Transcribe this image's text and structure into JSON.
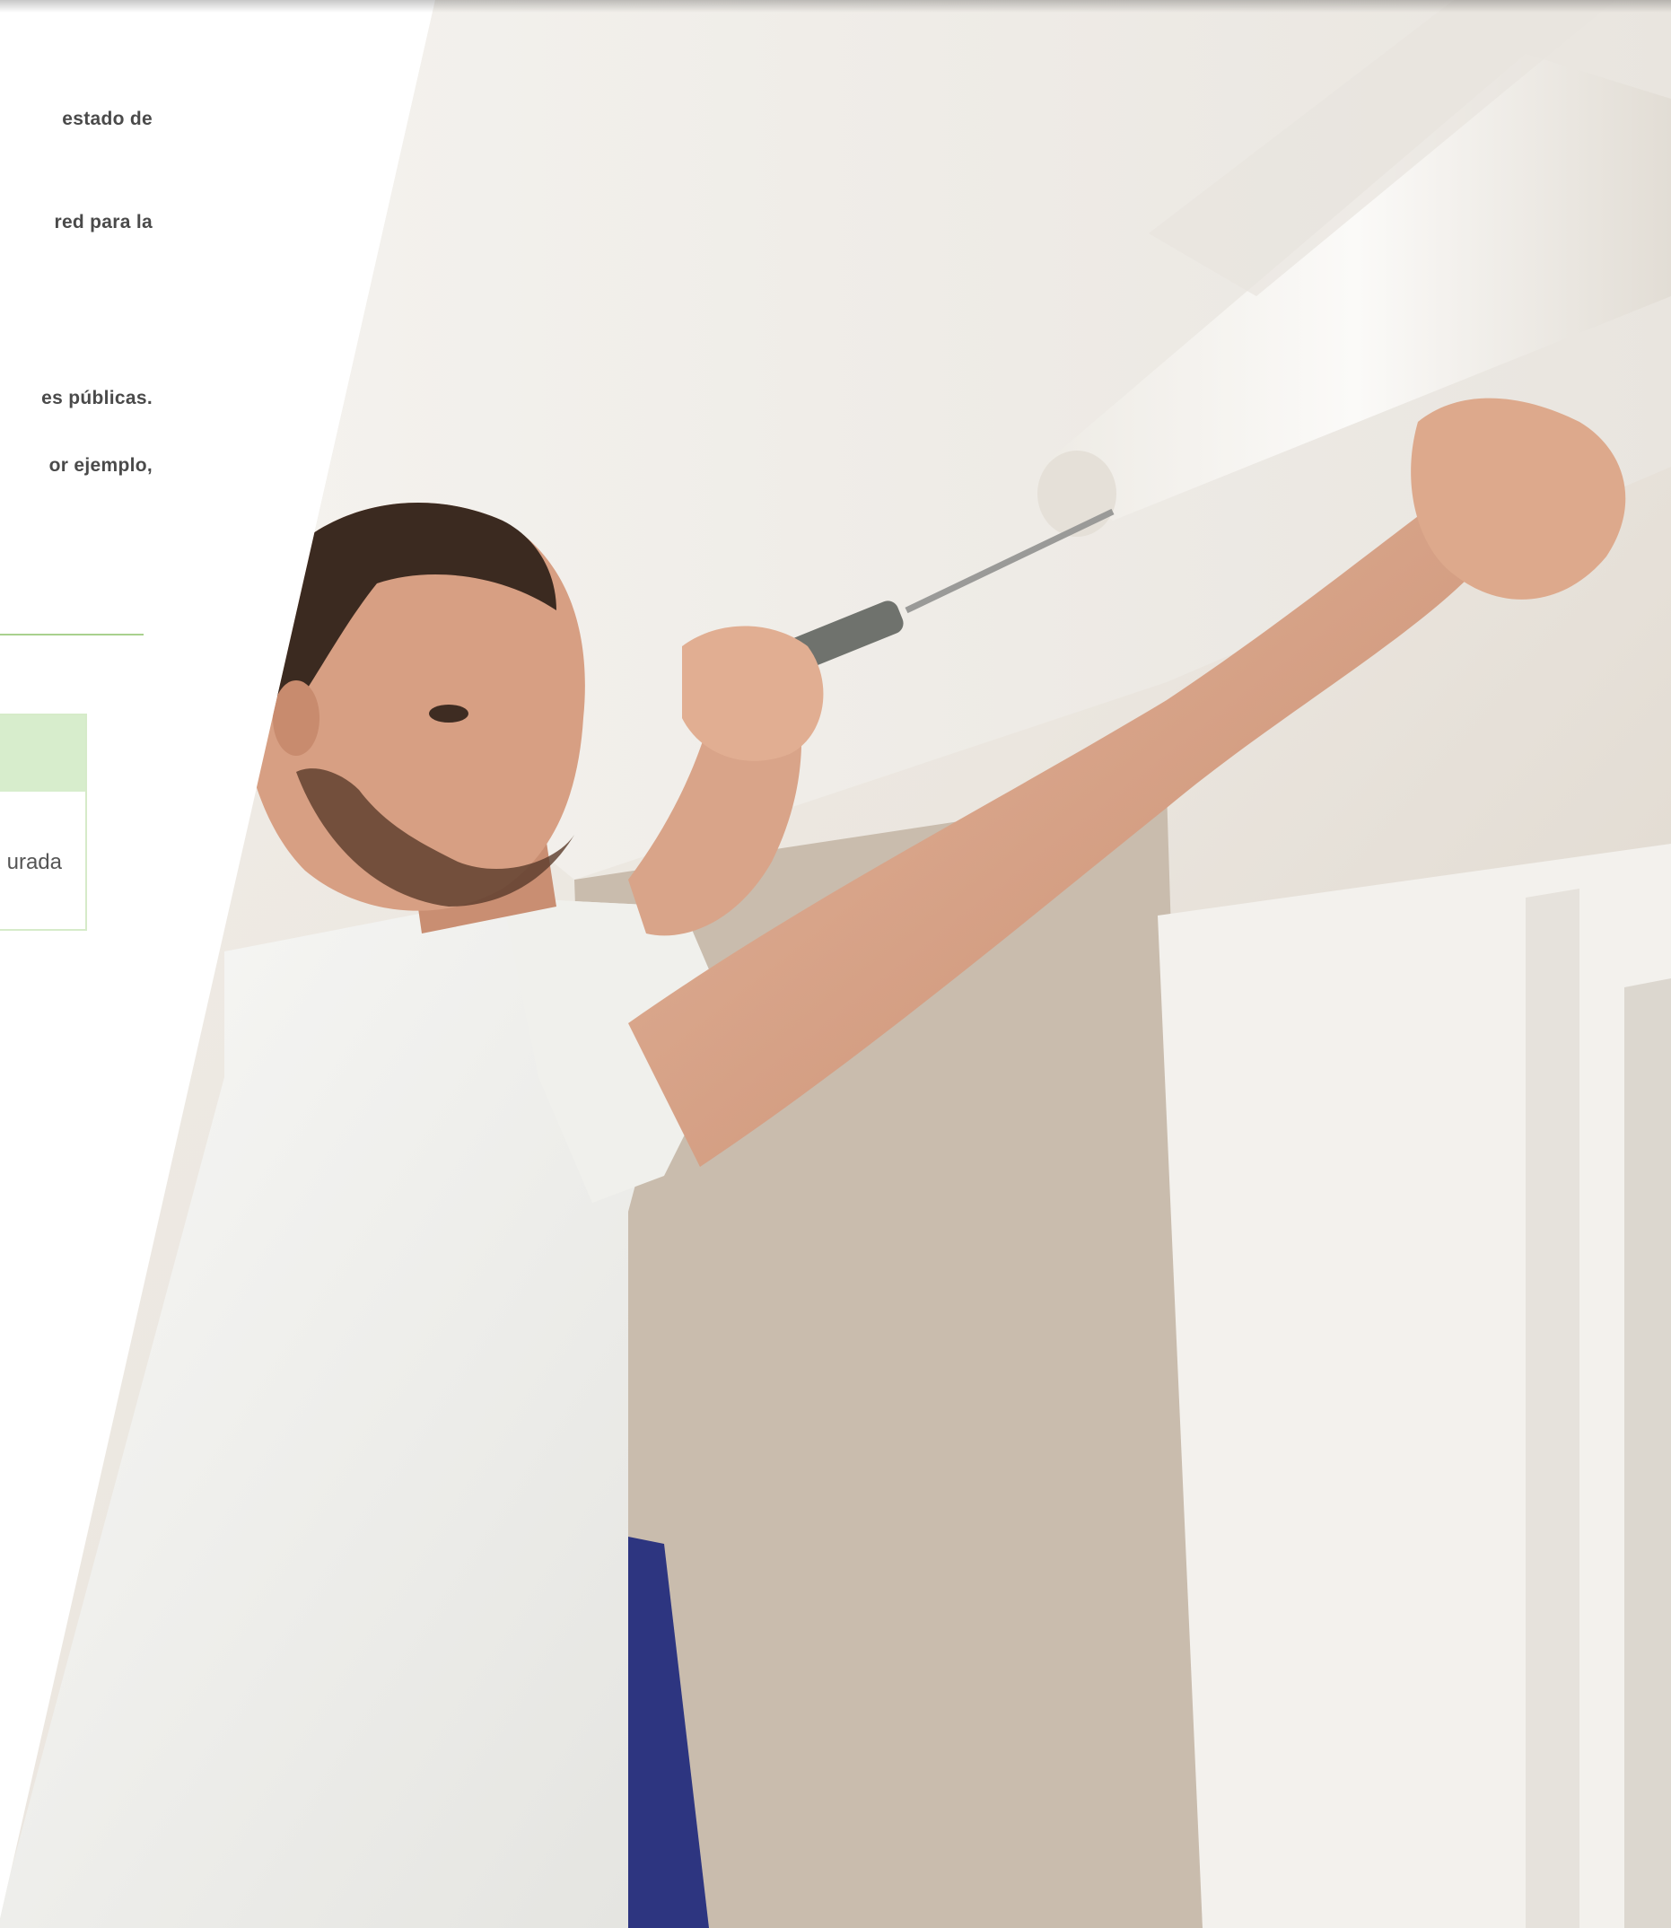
{
  "content": {
    "lines": [
      "estado de",
      "red para la",
      "es públicas.",
      "or ejemplo,"
    ],
    "table": {
      "cell": "urada"
    }
  },
  "photo": {
    "subject": "worker-installing-roller-blind-image"
  },
  "colors": {
    "accent_green": "#a9d18e",
    "table_header_bg": "#d7edcc",
    "text_gray": "#4a4a4a"
  }
}
